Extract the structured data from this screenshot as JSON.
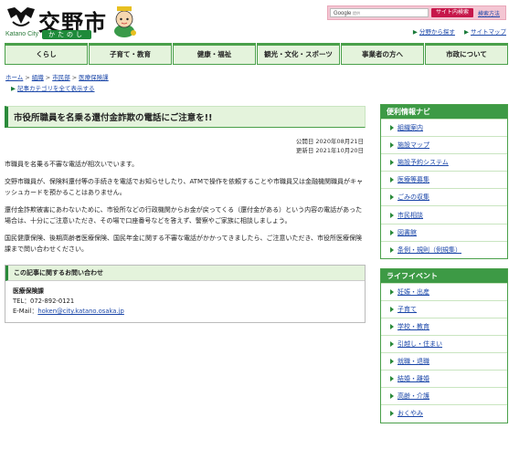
{
  "header": {
    "logo_title": "交野市",
    "logo_en": "Katano City",
    "logo_kana": "かたのし",
    "search_placeholder_main": "Google",
    "search_placeholder_sub": "提供",
    "search_button": "サイト内検索",
    "advanced_search": "検索方法",
    "util_links": [
      {
        "label": "分野から探す"
      },
      {
        "label": "サイトマップ"
      }
    ]
  },
  "nav": [
    {
      "label": "くらし"
    },
    {
      "label": "子育て・教育"
    },
    {
      "label": "健康・福祉"
    },
    {
      "label": "観光・文化・スポーツ"
    },
    {
      "label": "事業者の方へ"
    },
    {
      "label": "市政について"
    }
  ],
  "breadcrumb": {
    "items": [
      "ホーム",
      "組織",
      "市民部",
      "医療保険課"
    ],
    "show_all": "記事カテゴリを全て表示する"
  },
  "article": {
    "title": "市役所職員を名乗る還付金詐欺の電話にご注意を!!",
    "published": "公開日 2020年08月21日",
    "updated": "更新日 2021年10月20日",
    "paragraphs": [
      "市職員を名乗る不審な電話が相次いでいます。",
      "交野市職員が、保険料還付等の手続きを電話でお知らせしたり、ATMで操作を依頼することや市職員又は金融機関職員がキャッシュカードを預かることはありません。",
      "還付金詐欺被害にあわないために、市役所などの行政機関からお金が戻ってくる（還付金がある）という内容の電話があった場合は、十分にご注意いただき、その場で口座番号などを答えず、警察やご家族に相談しましょう。",
      "国民健康保険、後期高齢者医療保険、国民年金に関する不審な電話がかかってきましたら、ご注意いただき、市役所医療保険課まで問い合わせください。"
    ],
    "contact": {
      "heading": "この記事に関するお問い合わせ",
      "dept": "医療保険課",
      "tel": "TEL：072-892-0121",
      "email_label": "E-Mail：",
      "email": "hoken@city.katano.osaka.jp"
    }
  },
  "sidebar": {
    "convenience": {
      "heading": "便利情報ナビ",
      "items": [
        "組織案内",
        "施設マップ",
        "施設予約システム",
        "医療等募集",
        "ごみの収集",
        "市民相談",
        "図書館",
        "条例・規則（例規集）"
      ]
    },
    "life": {
      "heading": "ライフイベント",
      "items": [
        "妊娠・出産",
        "子育て",
        "学校・教育",
        "引越し・住まい",
        "就職・退職",
        "結婚・離婚",
        "高齢・介護",
        "おくやみ"
      ]
    }
  }
}
